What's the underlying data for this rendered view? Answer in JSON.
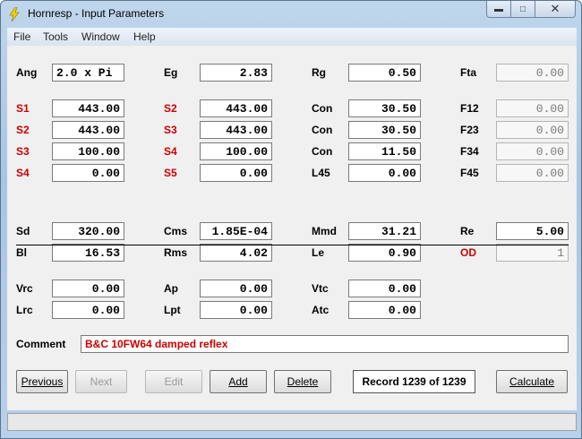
{
  "window": {
    "title": "Hornresp - Input Parameters"
  },
  "menu": [
    "File",
    "Tools",
    "Window",
    "Help"
  ],
  "rows": [
    {
      "c": [
        {
          "label": "Ang",
          "red": false,
          "value": "2.0 x Pi",
          "left": true
        },
        {
          "label": "Eg",
          "red": false,
          "value": "2.83"
        },
        {
          "label": "Rg",
          "red": false,
          "value": "0.50"
        },
        {
          "label": "Fta",
          "red": false,
          "value": "0.00",
          "dis": true
        }
      ]
    },
    {
      "c": [
        {
          "label": "S1",
          "red": true,
          "value": "443.00"
        },
        {
          "label": "S2",
          "red": true,
          "value": "443.00"
        },
        {
          "label": "Con",
          "red": false,
          "value": "30.50"
        },
        {
          "label": "F12",
          "red": false,
          "value": "0.00",
          "dis": true
        }
      ]
    },
    {
      "c": [
        {
          "label": "S2",
          "red": true,
          "value": "443.00"
        },
        {
          "label": "S3",
          "red": true,
          "value": "443.00"
        },
        {
          "label": "Con",
          "red": false,
          "value": "30.50"
        },
        {
          "label": "F23",
          "red": false,
          "value": "0.00",
          "dis": true
        }
      ]
    },
    {
      "c": [
        {
          "label": "S3",
          "red": true,
          "value": "100.00"
        },
        {
          "label": "S4",
          "red": true,
          "value": "100.00"
        },
        {
          "label": "Con",
          "red": false,
          "value": "11.50"
        },
        {
          "label": "F34",
          "red": false,
          "value": "0.00",
          "dis": true
        }
      ]
    },
    {
      "c": [
        {
          "label": "S4",
          "red": true,
          "value": "0.00"
        },
        {
          "label": "S5",
          "red": true,
          "value": "0.00"
        },
        {
          "label": "L45",
          "red": false,
          "value": "0.00"
        },
        {
          "label": "F45",
          "red": false,
          "value": "0.00",
          "dis": true
        }
      ]
    },
    {
      "c": [
        {
          "label": "Sd",
          "red": false,
          "value": "320.00"
        },
        {
          "label": "Cms",
          "red": false,
          "value": "1.85E-04"
        },
        {
          "label": "Mmd",
          "red": false,
          "value": "31.21"
        },
        {
          "label": "Re",
          "red": false,
          "value": "5.00"
        }
      ]
    },
    {
      "c": [
        {
          "label": "Bl",
          "red": false,
          "value": "16.53"
        },
        {
          "label": "Rms",
          "red": false,
          "value": "4.02"
        },
        {
          "label": "Le",
          "red": false,
          "value": "0.90"
        },
        {
          "label": "OD",
          "red": true,
          "value": "1",
          "dis": true
        }
      ]
    },
    {
      "c": [
        {
          "label": "Vrc",
          "red": false,
          "value": "0.00"
        },
        {
          "label": "Ap",
          "red": false,
          "value": "0.00"
        },
        {
          "label": "Vtc",
          "red": false,
          "value": "0.00"
        }
      ]
    },
    {
      "c": [
        {
          "label": "Lrc",
          "red": false,
          "value": "0.00"
        },
        {
          "label": "Lpt",
          "red": false,
          "value": "0.00"
        },
        {
          "label": "Atc",
          "red": false,
          "value": "0.00"
        }
      ]
    }
  ],
  "comment": {
    "label": "Comment",
    "value": "B&C 10FW64 damped reflex"
  },
  "buttons": {
    "previous": "Previous",
    "next": "Next",
    "edit": "Edit",
    "add": "Add",
    "delete": "Delete",
    "calculate": "Calculate"
  },
  "record": "Record 1239 of 1239"
}
